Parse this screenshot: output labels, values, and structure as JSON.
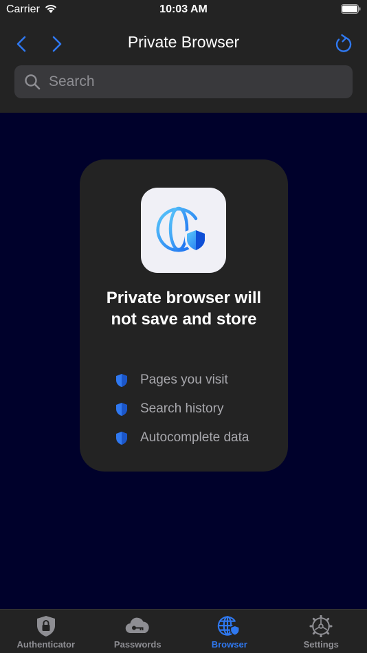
{
  "status_bar": {
    "carrier": "Carrier",
    "time": "10:03 AM"
  },
  "header": {
    "title": "Private Browser",
    "back_icon": "chevron-left-icon",
    "forward_icon": "chevron-right-icon",
    "reload_icon": "reload-icon"
  },
  "search": {
    "placeholder": "Search",
    "value": ""
  },
  "card": {
    "icon": "globe-shield-icon",
    "heading": "Private browser will not save and store",
    "items": [
      {
        "icon": "shield-icon",
        "label": "Pages you visit"
      },
      {
        "icon": "shield-icon",
        "label": "Search history"
      },
      {
        "icon": "shield-icon",
        "label": "Autocomplete data"
      }
    ]
  },
  "tab_bar": {
    "tabs": [
      {
        "label": "Authenticator",
        "icon": "lock-shield-icon",
        "active": false
      },
      {
        "label": "Passwords",
        "icon": "cloud-key-icon",
        "active": false
      },
      {
        "label": "Browser",
        "icon": "globe-shield-icon",
        "active": true
      },
      {
        "label": "Settings",
        "icon": "gear-icon",
        "active": false
      }
    ]
  },
  "colors": {
    "accent": "#2f78f0",
    "background": "#00012b",
    "surface": "#232323",
    "search_field": "#39393c",
    "muted_text": "#a8a8ad"
  }
}
